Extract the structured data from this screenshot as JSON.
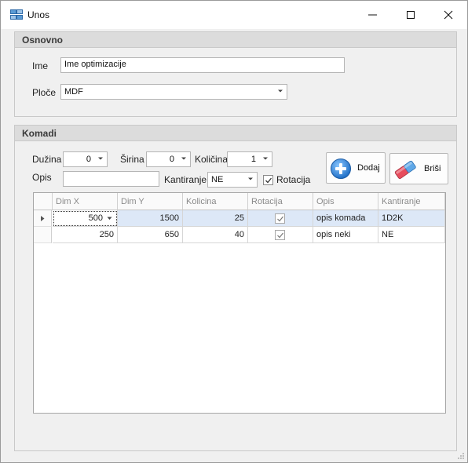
{
  "window": {
    "title": "Unos",
    "app_icon": "grid-form-icon",
    "controls": [
      "minimize-icon",
      "maximize-icon",
      "close-icon"
    ]
  },
  "osnovno": {
    "header": "Osnovno",
    "ime_label": "Ime",
    "ime_value": "Ime optimizacije",
    "ploce_label": "Ploče",
    "ploce_value": "MDF"
  },
  "komadi": {
    "header": "Komadi",
    "duzina_label": "Dužina",
    "duzina_value": "0",
    "sirina_label": "Širina",
    "sirina_value": "0",
    "kolicina_label": "Količina",
    "kolicina_value": "1",
    "opis_label": "Opis",
    "opis_value": "",
    "kantiranje_label": "Kantiranje",
    "kantiranje_value": "NE",
    "rotacija_label": "Rotacija",
    "rotacija_checked": true,
    "dodaj_label": "Dodaj",
    "brisi_label": "Briši",
    "dodaj_icon": "plus-circle-icon",
    "brisi_icon": "eraser-icon"
  },
  "grid": {
    "columns": [
      "Dim X",
      "Dim Y",
      "Kolicina",
      "Rotacija",
      "Opis",
      "Kantiranje"
    ],
    "rows": [
      {
        "dimx": "500",
        "dimy": "1500",
        "kolicina": "25",
        "rotacija": true,
        "opis": "opis komada",
        "kantiranje": "1D2K",
        "selected": true
      },
      {
        "dimx": "250",
        "dimy": "650",
        "kolicina": "40",
        "rotacija": true,
        "opis": "opis neki",
        "kantiranje": "NE",
        "selected": false
      }
    ]
  },
  "colors": {
    "accent_blue": "#2a7fd4",
    "selection": "#dde8f7",
    "group_header": "#dcdcdc"
  }
}
